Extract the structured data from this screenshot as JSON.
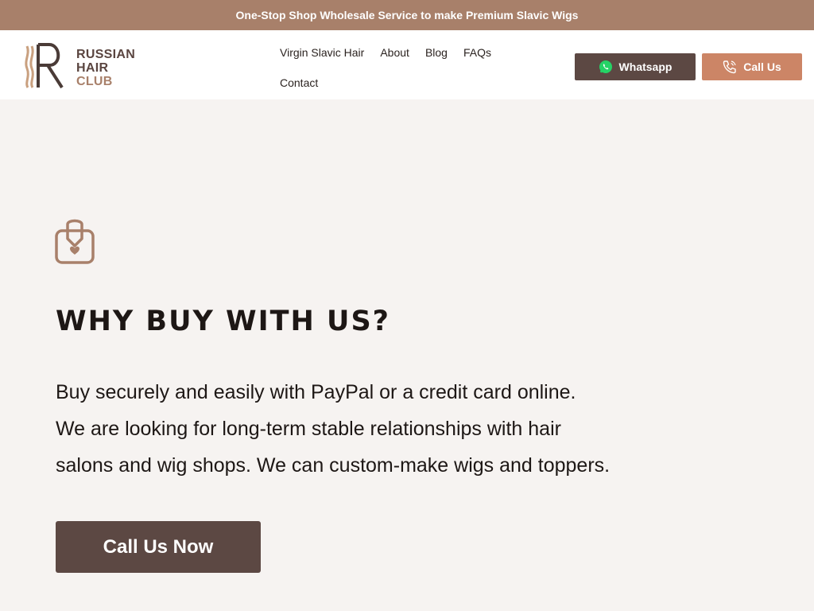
{
  "announcement": {
    "text": "One-Stop Shop Wholesale Service to make Premium Slavic Wigs"
  },
  "logo": {
    "line1": "RUSSIAN",
    "line2": "HAIR",
    "line3": "CLUB"
  },
  "nav": {
    "items": [
      {
        "label": "Virgin Slavic Hair"
      },
      {
        "label": "About"
      },
      {
        "label": "Blog"
      },
      {
        "label": "FAQs"
      },
      {
        "label": "Contact"
      }
    ]
  },
  "header_buttons": {
    "whatsapp": {
      "label": "Whatsapp",
      "icon": "whatsapp-icon"
    },
    "call": {
      "label": "Call Us",
      "icon": "phone-icon"
    }
  },
  "main": {
    "icon": "shopping-bag-heart-icon",
    "heading": "WHY BUY WITH US?",
    "body_lines": [
      "Buy securely and easily with PayPal or a credit card online.",
      "We are looking for long-term stable relationships with hair",
      "salons and wig shops. We can custom-make wigs and toppers."
    ],
    "cta_label": "Call Us Now"
  },
  "colors": {
    "announcement_bg": "#a8806a",
    "page_bg": "#f6f3f1",
    "dark_brown": "#5c4843",
    "accent": "#cc8566"
  }
}
